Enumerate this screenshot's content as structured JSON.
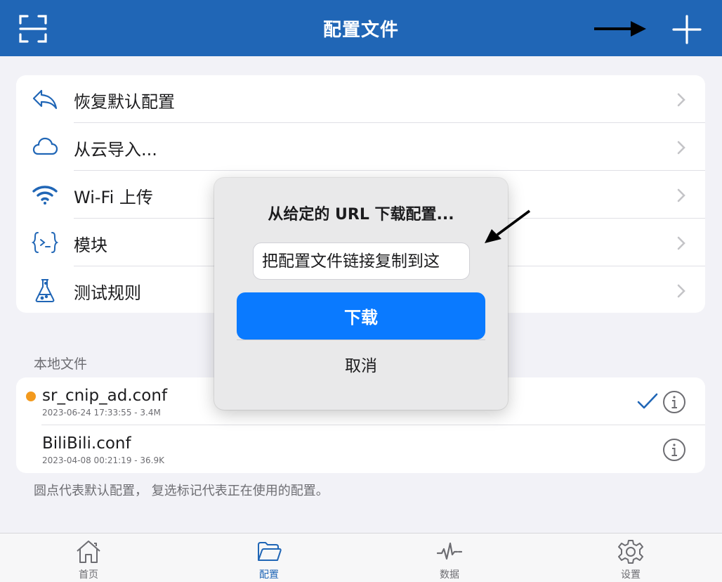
{
  "header": {
    "title": "配置文件",
    "bg_color": "#2066b6",
    "left_icon": "scan-icon",
    "right_icon": "plus-icon"
  },
  "menu": {
    "items": [
      {
        "label": "恢复默认配置",
        "icon": "undo-arrow-icon"
      },
      {
        "label": "从云导入...",
        "icon": "cloud-icon"
      },
      {
        "label": "Wi-Fi 上传",
        "icon": "wifi-icon"
      },
      {
        "label": "模块",
        "icon": "braces-icon"
      },
      {
        "label": "测试规则",
        "icon": "flask-icon"
      }
    ]
  },
  "local_files": {
    "section_title": "本地文件",
    "files": [
      {
        "name": "sr_cnip_ad.conf",
        "meta": "2023-06-24 17:33:55 - 3.4M",
        "default": true,
        "selected": true
      },
      {
        "name": "BiliBili.conf",
        "meta": "2023-04-08 00:21:19 - 36.9K",
        "default": false,
        "selected": false
      }
    ],
    "footnote": "圆点代表默认配置， 复选标记代表正在使用的配置。"
  },
  "dialog": {
    "title": "从给定的 URL 下载配置...",
    "input_placeholder": "把配置文件链接复制到这",
    "download_label": "下载",
    "cancel_label": "取消",
    "accent_color": "#0a7aff"
  },
  "tabbar": {
    "tabs": [
      {
        "label": "首页",
        "icon": "home-icon",
        "active": false
      },
      {
        "label": "配置",
        "icon": "folder-icon",
        "active": true
      },
      {
        "label": "数据",
        "icon": "pulse-icon",
        "active": false
      },
      {
        "label": "设置",
        "icon": "gear-icon",
        "active": false
      }
    ]
  },
  "colors": {
    "default_dot": "#f39a1e",
    "accent": "#2066b6"
  }
}
